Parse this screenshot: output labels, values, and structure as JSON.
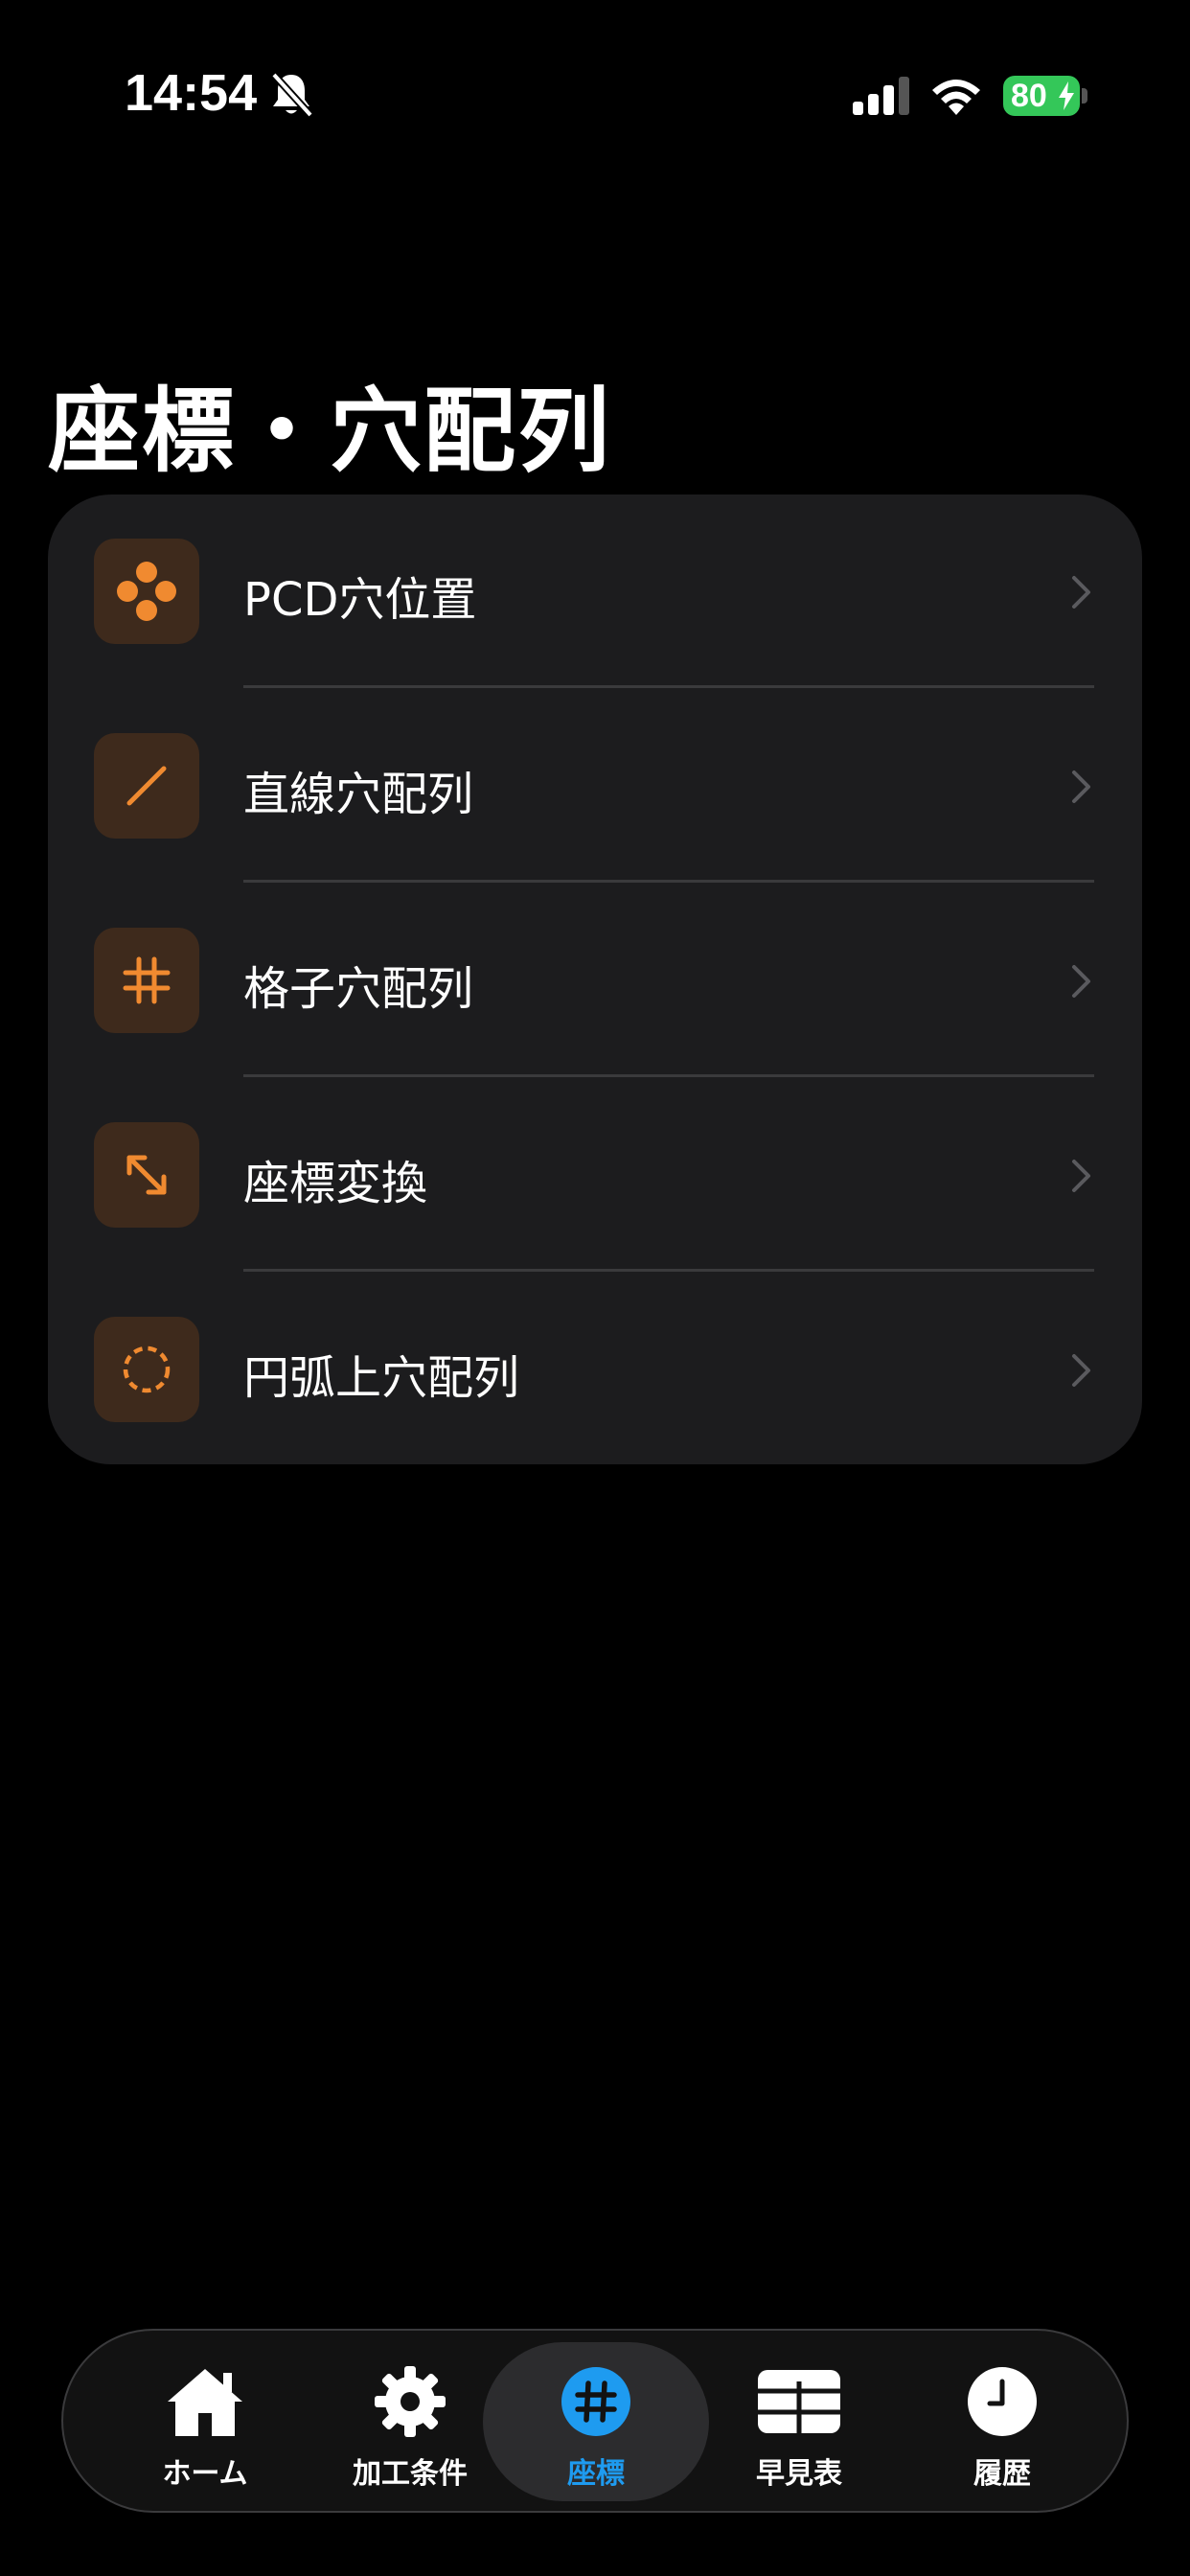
{
  "status_bar": {
    "time": "14:54",
    "battery": "80"
  },
  "page": {
    "title": "座標・穴配列"
  },
  "list": {
    "items": [
      {
        "label": "PCD穴位置",
        "icon": "pcd-dots-icon"
      },
      {
        "label": "直線穴配列",
        "icon": "line-icon"
      },
      {
        "label": "格子穴配列",
        "icon": "grid-hash-icon"
      },
      {
        "label": "座標変換",
        "icon": "expand-arrows-icon"
      },
      {
        "label": "円弧上穴配列",
        "icon": "dashed-circle-icon"
      }
    ]
  },
  "tab_bar": {
    "tabs": [
      {
        "label": "ホーム",
        "icon": "house-icon",
        "active": false
      },
      {
        "label": "加工条件",
        "icon": "gear-icon",
        "active": false
      },
      {
        "label": "座標",
        "icon": "number-sign-icon",
        "active": true
      },
      {
        "label": "早見表",
        "icon": "table-icon",
        "active": false
      },
      {
        "label": "履歴",
        "icon": "clock-icon",
        "active": false
      }
    ]
  },
  "colors": {
    "accent_orange": "#f08a30",
    "icon_bg": "#3e2a1c",
    "active_tab": "#1e9bf0",
    "card_bg": "#1c1c1e",
    "battery_green": "#34c759"
  }
}
